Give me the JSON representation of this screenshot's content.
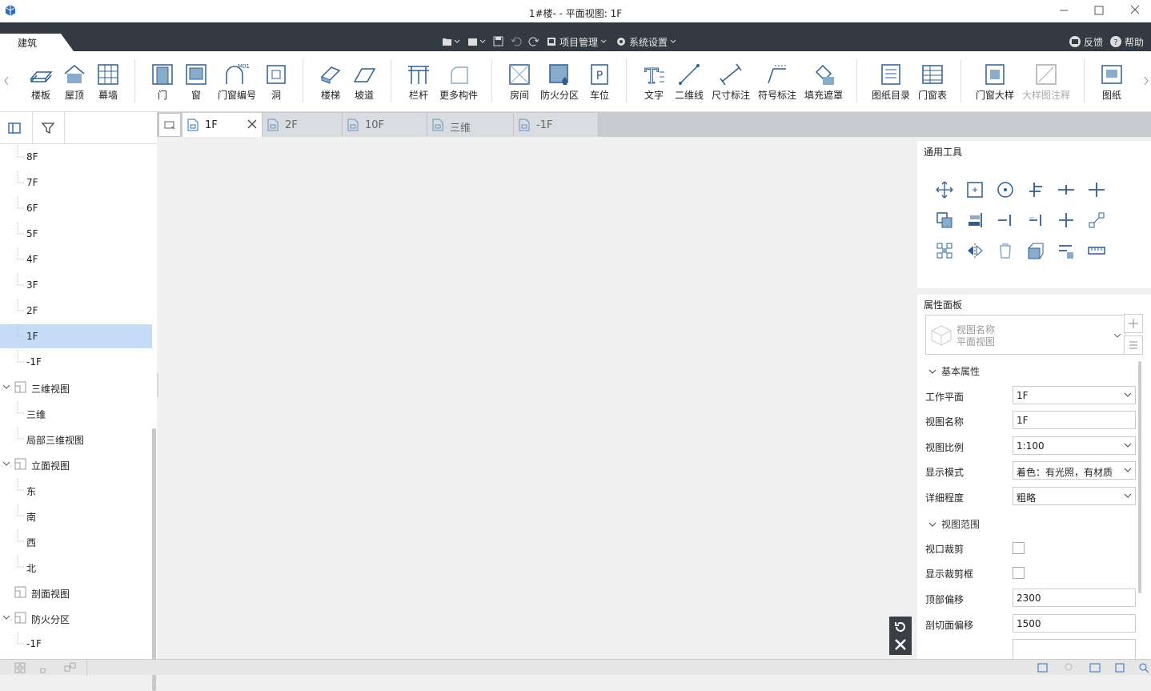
{
  "window": {
    "title": "1#楼- - 平面视图: 1F"
  },
  "ribbon": {
    "active_tab": "建筑",
    "header_items": {
      "project_manage": "项目管理",
      "system_settings": "系统设置"
    },
    "right_items": {
      "feedback": "反馈",
      "help": "帮助"
    }
  },
  "toolbar": {
    "stairs": "楼板",
    "roof": "屋顶",
    "curtain": "幕墙",
    "door": "门",
    "window": "窗",
    "window_code": "门窗编号",
    "hole": "洞",
    "stair": "楼梯",
    "ramp": "坡道",
    "railing": "栏杆",
    "more": "更多构件",
    "room": "房间",
    "fire_zone": "防火分区",
    "parking": "车位",
    "text": "文字",
    "line2d": "二维线",
    "dim": "尺寸标注",
    "symbol": "符号标注",
    "fill": "填充遮罩",
    "sheet_list": "图纸目录",
    "door_table": "门窗表",
    "detail": "门窗大样",
    "detail_note": "大样图注释",
    "drawing": "图纸",
    "win_code_icon_text": "M01"
  },
  "tree": {
    "items": [
      "8F",
      "7F",
      "6F",
      "5F",
      "4F",
      "3F",
      "2F",
      "1F",
      "-1F"
    ],
    "selected": "1F",
    "group_3d": "三维视图",
    "items_3d": [
      "三维",
      "局部三维视图"
    ],
    "group_elev": "立面视图",
    "items_elev": [
      "东",
      "南",
      "西",
      "北"
    ],
    "group_section": "剖面视图",
    "group_fire": "防火分区",
    "items_fire": [
      "-1F"
    ]
  },
  "tabs": [
    {
      "label": "1F",
      "active": true
    },
    {
      "label": "2F"
    },
    {
      "label": "10F"
    },
    {
      "label": "三维"
    },
    {
      "label": "-1F"
    }
  ],
  "right": {
    "general_tools_title": "通用工具",
    "props_title": "属性面板",
    "view_name_label": "视图名称",
    "view_type": "平面视图",
    "basic_props": "基本属性",
    "work_plane_label": "工作平面",
    "work_plane": "1F",
    "view_name2_label": "视图名称",
    "view_name2": "1F",
    "scale_label": "视图比例",
    "scale": "1:100",
    "display_label": "显示模式",
    "display": "着色：有光照，有材质",
    "detail_label": "详细程度",
    "detail": "粗略",
    "view_range": "视图范围",
    "crop_label": "视口裁剪",
    "crop_box_label": "显示裁剪框",
    "top_offset_label": "顶部偏移",
    "top_offset": "2300",
    "cut_offset_label": "剖切面偏移",
    "cut_offset": "1500"
  },
  "colors": {
    "accent": "#2f6fbf",
    "dark_header": "#333a42",
    "selected_row": "#c6dcf6"
  }
}
